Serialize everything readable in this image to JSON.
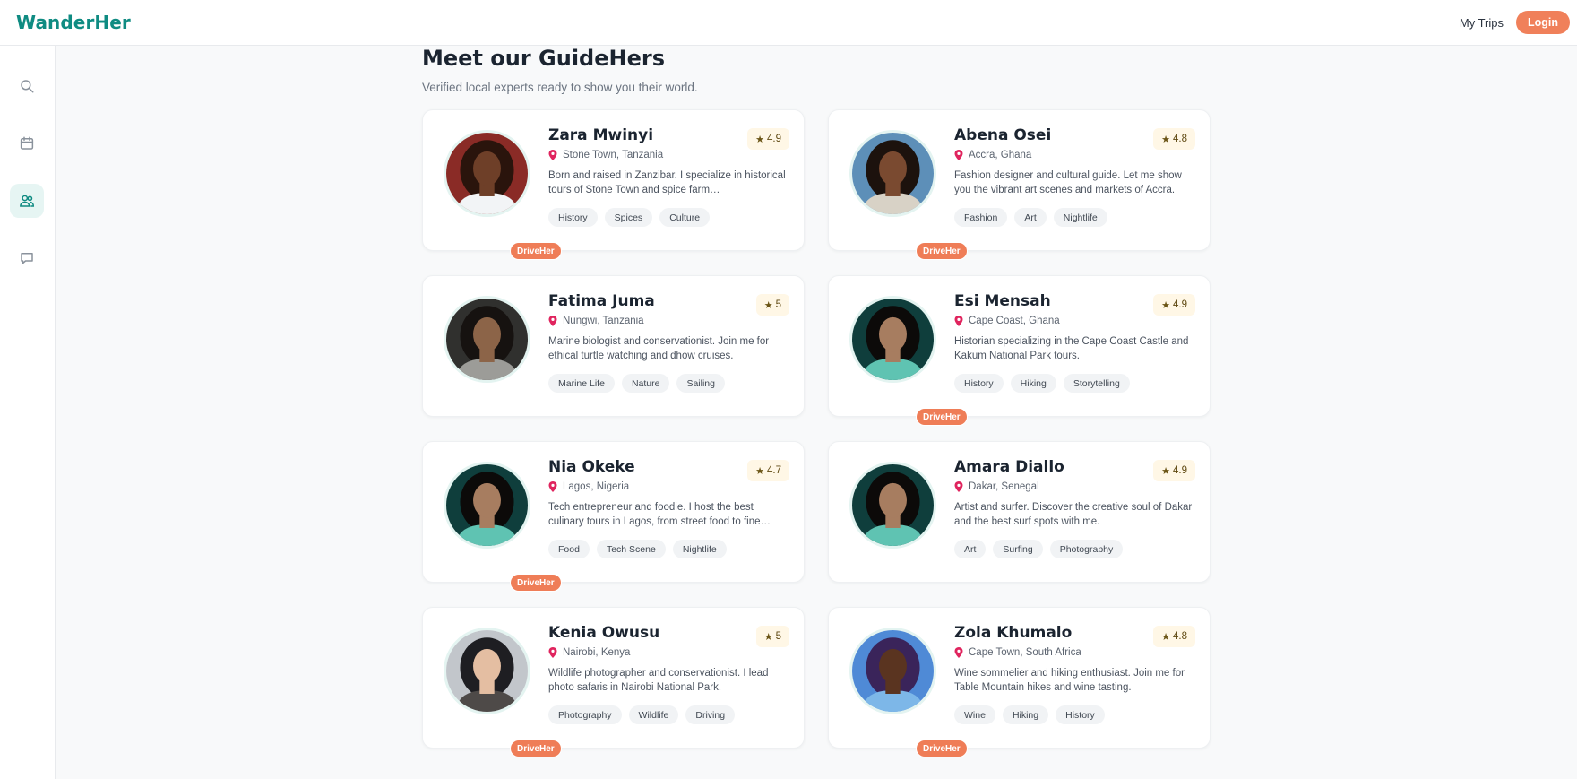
{
  "app": {
    "logo": "WanderHer"
  },
  "topbar": {
    "my_trips": "My Trips",
    "login": "Login"
  },
  "sidebar": {
    "items": [
      {
        "name": "search",
        "icon": "search-icon",
        "active": false
      },
      {
        "name": "calendar",
        "icon": "calendar-icon",
        "active": false
      },
      {
        "name": "guides",
        "icon": "users-icon",
        "active": true
      },
      {
        "name": "messages",
        "icon": "chat-icon",
        "active": false
      }
    ]
  },
  "page": {
    "title": "Meet our GuideHers",
    "subtitle": "Verified local experts ready to show you their world."
  },
  "colors": {
    "accent": "#0f8b82",
    "orange": "#ef7d57",
    "pin": "#e0245e",
    "rating_bg": "#fff7e6"
  },
  "badge_label": "DriveHer",
  "guides": [
    {
      "name": "Zara Mwinyi",
      "location": "Stone Town, Tanzania",
      "rating": "4.9",
      "bio": "Born and raised in Zanzibar. I specialize in historical tours of Stone Town and spice farm…",
      "tags": [
        "History",
        "Spices",
        "Culture"
      ],
      "driveher": true
    },
    {
      "name": "Abena Osei",
      "location": "Accra, Ghana",
      "rating": "4.8",
      "bio": "Fashion designer and cultural guide. Let me show you the vibrant art scenes and markets of Accra.",
      "tags": [
        "Fashion",
        "Art",
        "Nightlife"
      ],
      "driveher": true
    },
    {
      "name": "Fatima Juma",
      "location": "Nungwi, Tanzania",
      "rating": "5",
      "bio": "Marine biologist and conservationist. Join me for ethical turtle watching and dhow cruises.",
      "tags": [
        "Marine Life",
        "Nature",
        "Sailing"
      ],
      "driveher": false
    },
    {
      "name": "Esi Mensah",
      "location": "Cape Coast, Ghana",
      "rating": "4.9",
      "bio": "Historian specializing in the Cape Coast Castle and Kakum National Park tours.",
      "tags": [
        "History",
        "Hiking",
        "Storytelling"
      ],
      "driveher": true
    },
    {
      "name": "Nia Okeke",
      "location": "Lagos, Nigeria",
      "rating": "4.7",
      "bio": "Tech entrepreneur and foodie. I host the best culinary tours in Lagos, from street food to fine…",
      "tags": [
        "Food",
        "Tech Scene",
        "Nightlife"
      ],
      "driveher": true
    },
    {
      "name": "Amara Diallo",
      "location": "Dakar, Senegal",
      "rating": "4.9",
      "bio": "Artist and surfer. Discover the creative soul of Dakar and the best surf spots with me.",
      "tags": [
        "Art",
        "Surfing",
        "Photography"
      ],
      "driveher": false
    },
    {
      "name": "Kenia Owusu",
      "location": "Nairobi, Kenya",
      "rating": "5",
      "bio": "Wildlife photographer and conservationist. I lead photo safaris in Nairobi National Park.",
      "tags": [
        "Photography",
        "Wildlife",
        "Driving"
      ],
      "driveher": true
    },
    {
      "name": "Zola Khumalo",
      "location": "Cape Town, South Africa",
      "rating": "4.8",
      "bio": "Wine sommelier and hiking enthusiast. Join me for Table Mountain hikes and wine tasting.",
      "tags": [
        "Wine",
        "Hiking",
        "History"
      ],
      "driveher": true
    }
  ]
}
